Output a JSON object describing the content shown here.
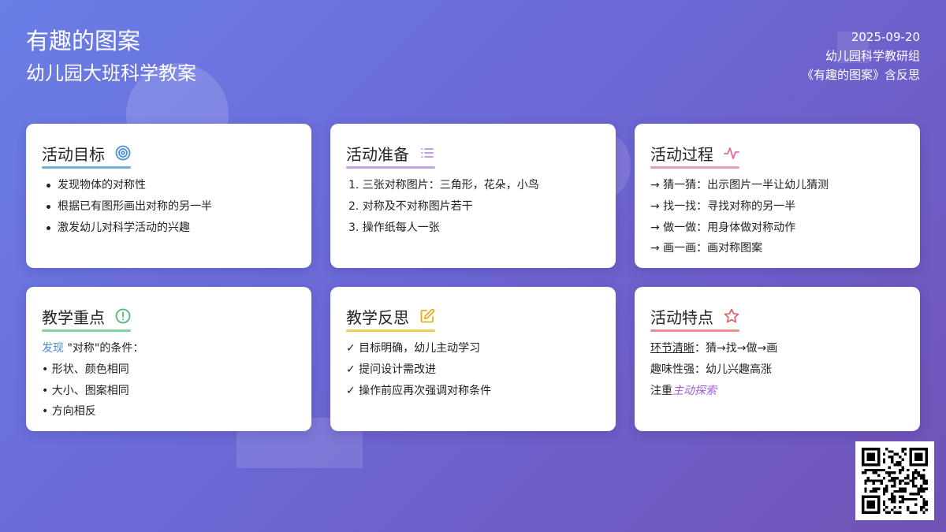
{
  "header": {
    "title": "有趣的图案",
    "subtitle": "幼儿园大班科学教案",
    "date": "2025-09-20",
    "group": "幼儿园科学教研组",
    "note": "《有趣的图案》含反思"
  },
  "cards": {
    "goals": {
      "title": "活动目标",
      "icon": "target-icon",
      "accent": "#6ab0e0",
      "items": [
        "发现物体的对称性",
        "根据已有图形画出对称的另一半",
        "激发幼儿对科学活动的兴趣"
      ]
    },
    "prep": {
      "title": "活动准备",
      "icon": "list-icon",
      "accent": "#c9a0e8",
      "items": [
        "1. 三张对称图片：三角形，花朵，小鸟",
        "2. 对称及不对称图片若干",
        "3. 操作纸每人一张"
      ]
    },
    "process": {
      "title": "活动过程",
      "icon": "activity-icon",
      "accent": "#e89ac0",
      "items": [
        "→ 猜一猜：出示图片一半让幼儿猜测",
        "→ 找一找：寻找对称的另一半",
        "→ 做一做：用身体做对称动作",
        "→ 画一画：画对称图案"
      ]
    },
    "focus": {
      "title": "教学重点",
      "icon": "alert-circle-icon",
      "accent": "#7ed69a",
      "lead_highlight": "发现",
      "lead_rest": " \"对称\"的条件：",
      "items": [
        "• 形状、颜色相同",
        "• 大小、图案相同",
        "• 方向相反"
      ]
    },
    "reflect": {
      "title": "教学反思",
      "icon": "edit-icon",
      "accent": "#f0cc50",
      "items": [
        "✓ 目标明确，幼儿主动学习",
        "✓ 提问设计需改进",
        "✓ 操作前应再次强调对称条件"
      ]
    },
    "features": {
      "title": "活动特点",
      "icon": "star-icon",
      "accent": "#ee8c90",
      "f1_label": "环节清晰",
      "f1_rest": "：猜→找→做→画",
      "f2": "趣味性强：幼儿兴趣高涨",
      "f3_label": "注重",
      "f3_highlight": "主动探索"
    }
  },
  "qr": {
    "icon": "qr-code-icon"
  }
}
